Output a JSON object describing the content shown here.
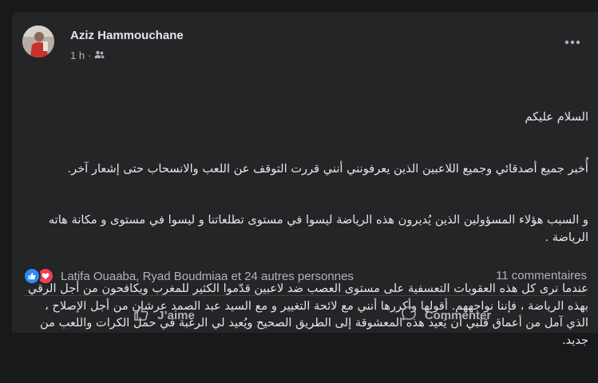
{
  "post": {
    "author": "Aziz Hammouchane",
    "time": "1 h",
    "separator": "·",
    "privacy_icon": "friends-icon",
    "more_icon": "more-icon",
    "lines": [
      "السلام عليكم",
      "أُخبر جميع أصدقائي وجميع اللاعبين الذين يعرفونني أنني قررت التوقف عن اللعب والانسحاب حتى إشعار آخر.",
      "و السبب هؤلاء المسؤولين الذين يُديرون هذه الرياضة ليسوا في مستوى تطلعاتنا و ليسوا في مستوى و مكانة هاته الرياضة .",
      "عندما نرى كل هذه العقوبات التعسفية على مستوى العصب ضد لاعبين قدّموا الكثير للمغرب ويكافحون من أجل الرقي بهذه الرياضة ، فإننا نواجههم. أقولها وأكررها أنني مع لائحة التغيير و مع السيد عبد الصمد عرشان من أجل الإصلاح ، الذي آمل من أعماق قلبي أن يُعيد هذه المعشوقة إلى الطريق الصحيح ويُعيد لي الرغبة في حمل الكرات واللعب من جديد."
    ]
  },
  "reactions": {
    "like_icon": "like-reaction-icon",
    "love_icon": "love-reaction-icon",
    "summary": "Latifa Ouaaba, Ryad Boudmiaa et 24 autres personnes",
    "like_color": "#2d88ff",
    "love_color": "#f33e58"
  },
  "comments": {
    "count_label": "11 commentaires"
  },
  "actions": {
    "like_label": "J’aime",
    "comment_label": "Commenter"
  },
  "colors": {
    "background": "#18191a",
    "card": "#242526",
    "text_primary": "#e4e6eb",
    "text_secondary": "#b0b3b8"
  }
}
